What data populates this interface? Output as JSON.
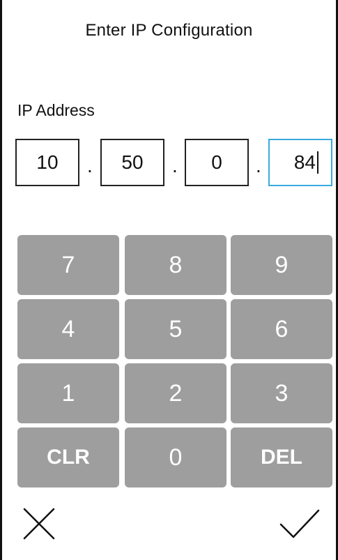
{
  "dialog": {
    "title": "Enter IP Configuration",
    "field_label": "IP Address"
  },
  "ip": {
    "octets": [
      "10",
      "50",
      "0",
      "84"
    ],
    "separator": ".",
    "active_octet_index": 3
  },
  "keypad": {
    "keys": [
      "7",
      "8",
      "9",
      "4",
      "5",
      "6",
      "1",
      "2",
      "3",
      "CLR",
      "0",
      "DEL"
    ]
  },
  "actions": {
    "cancel_icon": "close-icon",
    "confirm_icon": "checkmark-icon"
  },
  "colors": {
    "key_background": "#9e9e9e",
    "key_text": "#ffffff",
    "active_border": "#39a9e0",
    "text": "#111111"
  }
}
